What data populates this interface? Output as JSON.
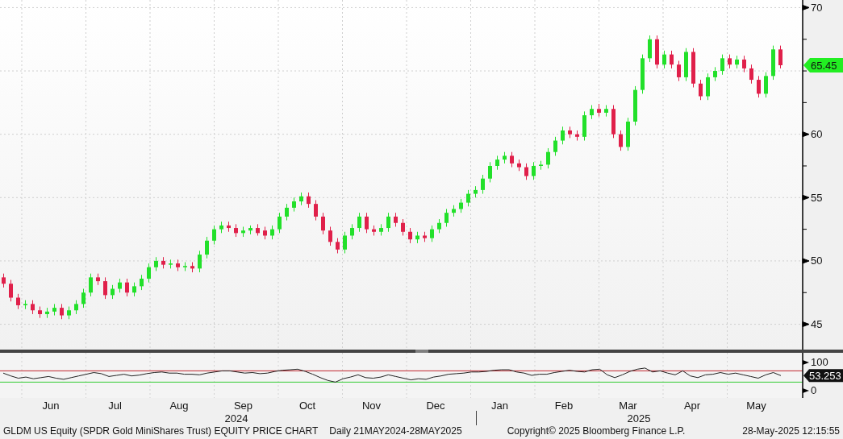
{
  "price_chart": {
    "chart_data": {
      "type": "candlestick",
      "categories": [
        null,
        null,
        null,
        null,
        null,
        null,
        null,
        null,
        null,
        null,
        null,
        null,
        null,
        null,
        null,
        null,
        null,
        null,
        null,
        null,
        null,
        null,
        null,
        null,
        null,
        null,
        null,
        null,
        null,
        null,
        null,
        null,
        null,
        null,
        null,
        null,
        null,
        null,
        null,
        null,
        null,
        null,
        null,
        null,
        null,
        null,
        null,
        null,
        null,
        null,
        null,
        null,
        null,
        null,
        null,
        null,
        null,
        null,
        null,
        null,
        null,
        null,
        null,
        null,
        null,
        null,
        null,
        null,
        null,
        null,
        null,
        null,
        null,
        null,
        null,
        null,
        null,
        null,
        null,
        null,
        null,
        null,
        null,
        null,
        null,
        null,
        null,
        null,
        null,
        null,
        null,
        null,
        null,
        null,
        null,
        null,
        null,
        null,
        null,
        null,
        null,
        null,
        null,
        null,
        null,
        null,
        null,
        null
      ],
      "ylim": [
        43,
        70.6
      ],
      "yticks": [
        45,
        50,
        55,
        60,
        70
      ],
      "grid": true,
      "ohlc": [
        [
          48.7,
          49.0,
          47.9,
          48.2
        ],
        [
          48.2,
          48.5,
          46.8,
          47.1
        ],
        [
          47.1,
          47.4,
          46.2,
          46.5
        ],
        [
          46.5,
          46.9,
          46.2,
          46.6
        ],
        [
          46.6,
          46.9,
          45.8,
          46.1
        ],
        [
          46.1,
          46.4,
          45.5,
          45.8
        ],
        [
          45.8,
          46.3,
          45.5,
          46.0
        ],
        [
          46.0,
          46.6,
          45.7,
          46.3
        ],
        [
          46.3,
          46.6,
          45.4,
          45.7
        ],
        [
          45.7,
          46.4,
          45.4,
          46.1
        ],
        [
          46.1,
          46.9,
          45.8,
          46.6
        ],
        [
          46.6,
          47.8,
          46.3,
          47.5
        ],
        [
          47.5,
          49.0,
          47.2,
          48.7
        ],
        [
          48.7,
          49.0,
          48.1,
          48.4
        ],
        [
          48.4,
          48.7,
          47.0,
          47.3
        ],
        [
          47.3,
          48.1,
          47.0,
          47.8
        ],
        [
          47.8,
          48.6,
          47.5,
          48.3
        ],
        [
          48.3,
          48.6,
          47.2,
          47.5
        ],
        [
          47.5,
          48.3,
          47.2,
          48.0
        ],
        [
          48.0,
          48.9,
          47.7,
          48.6
        ],
        [
          48.6,
          49.8,
          48.3,
          49.5
        ],
        [
          49.5,
          50.3,
          49.2,
          50.0
        ],
        [
          50.0,
          50.3,
          49.4,
          49.7
        ],
        [
          49.7,
          50.1,
          49.4,
          49.8
        ],
        [
          49.8,
          50.1,
          49.2,
          49.5
        ],
        [
          49.5,
          49.9,
          49.2,
          49.6
        ],
        [
          49.6,
          49.9,
          49.1,
          49.4
        ],
        [
          49.4,
          50.8,
          49.1,
          50.5
        ],
        [
          50.5,
          51.9,
          50.2,
          51.6
        ],
        [
          51.6,
          52.8,
          51.3,
          52.5
        ],
        [
          52.5,
          53.1,
          52.2,
          52.8
        ],
        [
          52.8,
          53.1,
          52.3,
          52.6
        ],
        [
          52.6,
          52.9,
          51.9,
          52.2
        ],
        [
          52.2,
          52.7,
          51.9,
          52.4
        ],
        [
          52.4,
          52.8,
          52.1,
          52.6
        ],
        [
          52.6,
          52.9,
          52.0,
          52.2
        ],
        [
          52.4,
          52.7,
          51.7,
          52.0
        ],
        [
          52.0,
          52.8,
          51.7,
          52.5
        ],
        [
          52.5,
          53.8,
          52.2,
          53.5
        ],
        [
          53.5,
          54.5,
          53.2,
          54.2
        ],
        [
          54.2,
          55.0,
          53.9,
          54.7
        ],
        [
          54.7,
          55.4,
          54.4,
          55.1
        ],
        [
          55.1,
          55.4,
          54.2,
          54.5
        ],
        [
          54.5,
          54.8,
          53.2,
          53.5
        ],
        [
          53.5,
          53.8,
          52.1,
          52.4
        ],
        [
          52.4,
          52.7,
          51.2,
          51.5
        ],
        [
          51.5,
          51.8,
          50.6,
          50.9
        ],
        [
          50.9,
          52.3,
          50.6,
          52.0
        ],
        [
          52.0,
          52.9,
          51.7,
          52.6
        ],
        [
          52.6,
          53.8,
          52.3,
          53.5
        ],
        [
          53.5,
          53.8,
          52.2,
          52.5
        ],
        [
          52.5,
          52.8,
          52.0,
          52.3
        ],
        [
          52.3,
          52.9,
          52.0,
          52.6
        ],
        [
          52.6,
          53.8,
          52.3,
          53.5
        ],
        [
          53.5,
          53.8,
          52.7,
          53.0
        ],
        [
          53.0,
          53.3,
          52.0,
          52.3
        ],
        [
          52.3,
          52.6,
          51.4,
          51.7
        ],
        [
          51.7,
          52.3,
          51.4,
          52.0
        ],
        [
          52.0,
          52.3,
          51.5,
          51.8
        ],
        [
          51.8,
          52.8,
          51.5,
          52.5
        ],
        [
          52.5,
          53.3,
          52.2,
          53.0
        ],
        [
          53.0,
          54.1,
          52.7,
          53.8
        ],
        [
          53.8,
          54.4,
          53.5,
          54.1
        ],
        [
          54.1,
          54.9,
          53.8,
          54.6
        ],
        [
          54.6,
          55.6,
          54.3,
          55.3
        ],
        [
          55.3,
          55.9,
          55.0,
          55.6
        ],
        [
          55.6,
          56.8,
          55.3,
          56.5
        ],
        [
          56.5,
          57.8,
          56.2,
          57.5
        ],
        [
          57.5,
          58.3,
          57.2,
          58.0
        ],
        [
          58.0,
          58.6,
          57.7,
          58.3
        ],
        [
          58.3,
          58.6,
          57.4,
          57.7
        ],
        [
          57.7,
          58.0,
          57.1,
          57.4
        ],
        [
          57.4,
          57.7,
          56.4,
          56.7
        ],
        [
          56.7,
          57.8,
          56.4,
          57.5
        ],
        [
          57.5,
          57.9,
          57.2,
          57.6
        ],
        [
          57.6,
          58.9,
          57.3,
          58.6
        ],
        [
          58.6,
          59.8,
          58.3,
          59.5
        ],
        [
          59.5,
          60.6,
          59.2,
          60.3
        ],
        [
          60.3,
          60.6,
          59.7,
          60.0
        ],
        [
          60.0,
          60.3,
          59.5,
          59.8
        ],
        [
          59.8,
          61.8,
          59.5,
          61.5
        ],
        [
          61.5,
          62.3,
          61.2,
          62.0
        ],
        [
          62.0,
          62.4,
          61.4,
          61.7
        ],
        [
          61.7,
          62.3,
          61.4,
          62.0
        ],
        [
          62.0,
          62.3,
          59.7,
          60.0
        ],
        [
          60.0,
          60.3,
          58.7,
          59.0
        ],
        [
          59.0,
          61.3,
          58.7,
          61.0
        ],
        [
          61.0,
          63.8,
          60.7,
          63.5
        ],
        [
          63.5,
          66.3,
          63.2,
          66.0
        ],
        [
          66.0,
          67.8,
          65.7,
          67.5
        ],
        [
          67.5,
          67.8,
          65.2,
          65.5
        ],
        [
          65.5,
          66.6,
          65.2,
          66.3
        ],
        [
          66.3,
          66.6,
          65.2,
          65.5
        ],
        [
          65.5,
          65.8,
          64.2,
          64.5
        ],
        [
          64.5,
          66.8,
          64.2,
          66.5
        ],
        [
          66.5,
          66.8,
          63.7,
          64.0
        ],
        [
          64.0,
          64.3,
          62.7,
          63.0
        ],
        [
          63.0,
          64.8,
          62.7,
          64.5
        ],
        [
          64.5,
          65.3,
          64.2,
          65.0
        ],
        [
          65.0,
          66.3,
          64.7,
          66.0
        ],
        [
          66.0,
          66.3,
          65.2,
          65.5
        ],
        [
          65.5,
          66.2,
          65.2,
          65.9
        ],
        [
          65.9,
          66.2,
          64.9,
          65.2
        ],
        [
          65.2,
          65.5,
          64.0,
          64.3
        ],
        [
          64.3,
          64.6,
          62.9,
          63.2
        ],
        [
          63.2,
          64.9,
          62.9,
          64.6
        ],
        [
          64.6,
          67.0,
          64.3,
          66.7
        ],
        [
          66.7,
          67.0,
          65.2,
          65.45
        ]
      ]
    },
    "last_price": "65.45"
  },
  "indicator_chart": {
    "chart_data": {
      "type": "line",
      "categories": [
        null,
        null,
        null,
        null,
        null,
        null,
        null,
        null,
        null,
        null,
        null,
        null,
        null,
        null,
        null,
        null,
        null,
        null,
        null,
        null,
        null,
        null,
        null,
        null,
        null,
        null,
        null,
        null,
        null,
        null,
        null,
        null,
        null,
        null,
        null,
        null,
        null,
        null,
        null,
        null,
        null,
        null,
        null,
        null,
        null,
        null,
        null,
        null,
        null,
        null,
        null,
        null,
        null,
        null,
        null,
        null,
        null,
        null,
        null,
        null,
        null,
        null,
        null,
        null,
        null,
        null,
        null,
        null,
        null,
        null,
        null,
        null,
        null,
        null,
        null,
        null,
        null,
        null,
        null,
        null,
        null,
        null,
        null,
        null,
        null,
        null,
        null,
        null,
        null,
        null,
        null,
        null,
        null,
        null,
        null,
        null,
        null,
        null,
        null,
        null,
        null,
        null,
        null,
        null
      ],
      "ylim": [
        -26,
        134
      ],
      "yticks": [
        0,
        100
      ],
      "grid": true,
      "series": [
        {
          "color": "#222222",
          "values": [
            62,
            52,
            44,
            48,
            42,
            46,
            50,
            44,
            40,
            46,
            52,
            58,
            64,
            60,
            50,
            54,
            58,
            52,
            55,
            60,
            64,
            66,
            62,
            62,
            58,
            58,
            56,
            62,
            66,
            70,
            70,
            66,
            62,
            64,
            60,
            62,
            68,
            72,
            74,
            76,
            68,
            58,
            46,
            36,
            30,
            42,
            48,
            56,
            46,
            44,
            48,
            56,
            50,
            44,
            38,
            42,
            40,
            48,
            52,
            58,
            60,
            62,
            66,
            66,
            68,
            72,
            74,
            74,
            66,
            62,
            54,
            58,
            58,
            64,
            68,
            72,
            68,
            66,
            74,
            76,
            56,
            46,
            56,
            68,
            76,
            80,
            66,
            70,
            62,
            56,
            70,
            52,
            46,
            56,
            58,
            64,
            58,
            62,
            56,
            50,
            44,
            56,
            64,
            53
          ]
        }
      ],
      "ref_lines": [
        {
          "axis": "y",
          "value": 70,
          "color": "#c0262e"
        },
        {
          "axis": "y",
          "value": 30,
          "color": "#33cc33"
        }
      ]
    },
    "last_value": "53.253"
  },
  "x_axis": {
    "months": [
      "Jun",
      "Jul",
      "Aug",
      "Sep",
      "Oct",
      "Nov",
      "Dec",
      "Jan",
      "Feb",
      "Mar",
      "Apr",
      "May"
    ],
    "years": [
      "2024",
      "2025"
    ]
  },
  "footer": {
    "description": "GLDM US Equity (SPDR Gold MiniShares Trust) EQUITY PRICE CHART",
    "range": "Daily 21MAY2024-28MAY2025",
    "copyright": "Copyright© 2025 Bloomberg Finance L.P.",
    "timestamp": "28-May-2025 12:15:55"
  }
}
